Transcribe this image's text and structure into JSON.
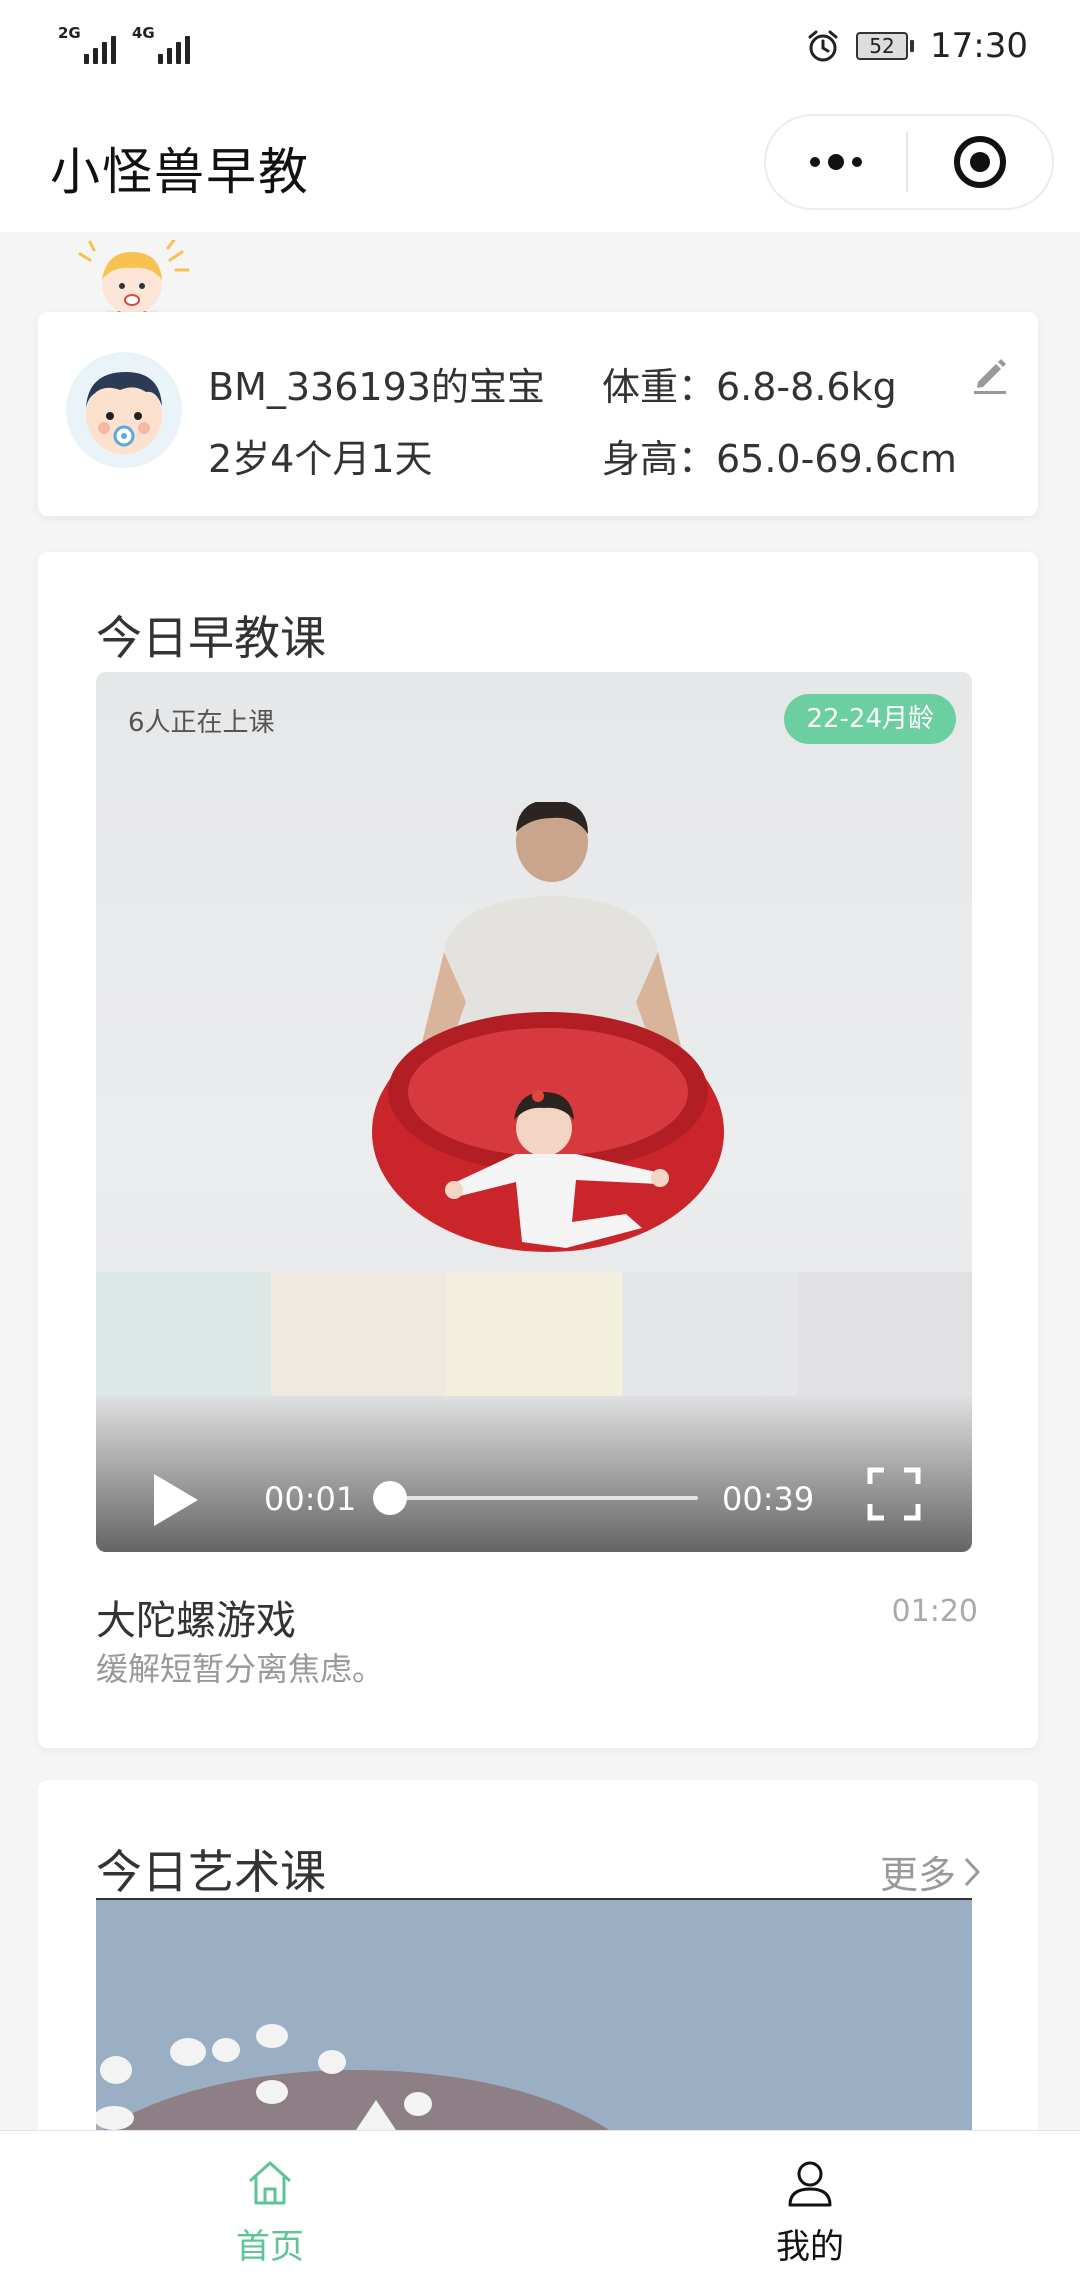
{
  "status_bar": {
    "net1": "2G",
    "net2": "4G",
    "battery": "52",
    "time": "17:30"
  },
  "header": {
    "title": "小怪兽早教"
  },
  "profile": {
    "name": "BM_336193的宝宝",
    "age": "2岁4个月1天",
    "weight": "体重：6.8-8.6kg",
    "height": "身高：65.0-69.6cm"
  },
  "early_edu": {
    "title": "今日早教课",
    "video": {
      "learners": "6人正在上课",
      "age_badge": "22-24月龄",
      "current_time": "00:01",
      "total_time": "00:39",
      "progress": 0.03
    },
    "course": {
      "name": "大陀螺游戏",
      "duration": "01:20",
      "description": "缓解短暂分离焦虑。"
    }
  },
  "art": {
    "title": "今日艺术课",
    "more": "更多"
  },
  "tabs": [
    {
      "label": "首页",
      "icon": "home-icon",
      "active": true
    },
    {
      "label": "我的",
      "icon": "user-icon",
      "active": false
    }
  ],
  "colors": {
    "accent": "#5ec396",
    "badge": "#6bcfa2",
    "bowl": "#c9252b"
  }
}
